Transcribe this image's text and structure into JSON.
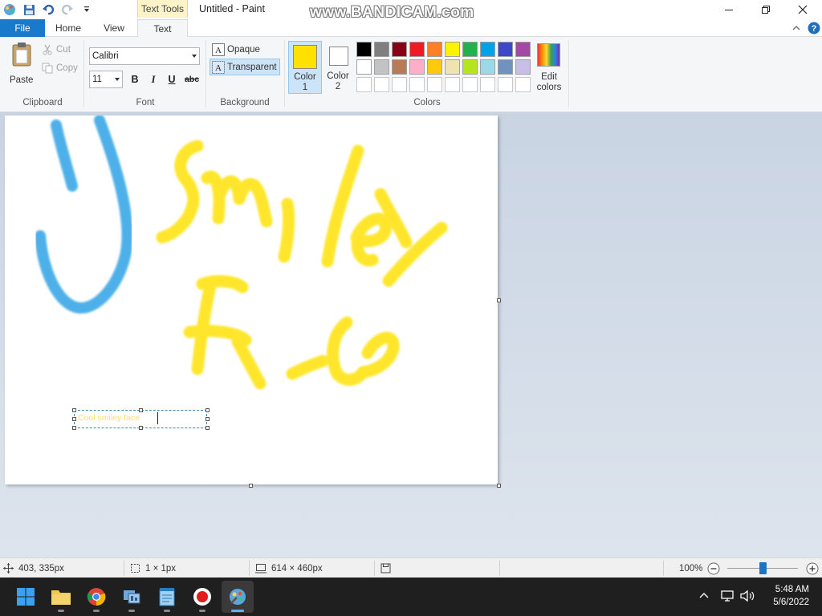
{
  "window": {
    "title": "Untitled - Paint",
    "contextual_tab": "Text Tools",
    "watermark": "www.BANDICAM.com"
  },
  "tabs": [
    "File",
    "Home",
    "View",
    "Text"
  ],
  "active_tab": "Text",
  "ribbon": {
    "clipboard": {
      "paste": "Paste",
      "cut": "Cut",
      "copy": "Copy",
      "label": "Clipboard"
    },
    "font": {
      "family": "Calibri",
      "size": "11",
      "bold": "B",
      "italic": "I",
      "underline": "U",
      "strike": "abc",
      "label": "Font"
    },
    "background": {
      "opaque": "Opaque",
      "transparent": "Transparent",
      "label": "Background",
      "selected": "Transparent"
    },
    "colors": {
      "color1_label": "Color",
      "color1_num": "1",
      "color2_label": "Color",
      "color2_num": "2",
      "color1": "#ffe100",
      "color2": "#ffffff",
      "edit": "Edit",
      "edit2": "colors",
      "label": "Colors",
      "palette_row1": [
        "#000000",
        "#7f7f7f",
        "#880015",
        "#ed1c24",
        "#ff7f27",
        "#fff200",
        "#22b14c",
        "#00a2e8",
        "#3f48cc",
        "#a349a4"
      ],
      "palette_row2": [
        "#ffffff",
        "#c3c3c3",
        "#b97a57",
        "#ffaec9",
        "#ffc90e",
        "#efe4b0",
        "#b5e61d",
        "#99d9ea",
        "#7092be",
        "#c8bfe7"
      ]
    }
  },
  "canvas": {
    "text_box_content": "Cool smiley face",
    "drawing_colors": {
      "blue": "#3aa8e6",
      "yellow": "#ffe419"
    }
  },
  "status": {
    "cursor_pos": "403, 335px",
    "selection_size": "1 × 1px",
    "image_size": "614 × 460px",
    "zoom": "100%",
    "zoom_fraction": 0.5
  },
  "taskbar": {
    "time": "5:48 AM",
    "date": "5/6/2022"
  }
}
